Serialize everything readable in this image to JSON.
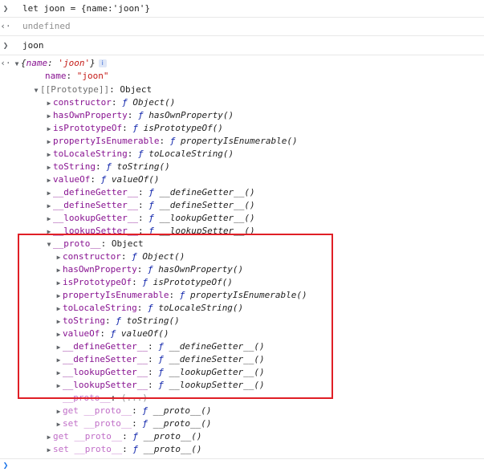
{
  "console": {
    "input1": "let joon = {name:'joon'}",
    "result1": "undefined",
    "input2": "joon",
    "object_preview": {
      "open": "{",
      "key": "name",
      "sep": ": ",
      "value": "'joon'",
      "close": "}"
    },
    "name_prop": {
      "key": "name",
      "value": "\"joon\""
    },
    "prototype_label": {
      "key": "[[Prototype]]",
      "value": "Object"
    },
    "level1_methods": [
      {
        "key": "constructor",
        "sig": "Object()"
      },
      {
        "key": "hasOwnProperty",
        "sig": "hasOwnProperty()"
      },
      {
        "key": "isPrototypeOf",
        "sig": "isPrototypeOf()"
      },
      {
        "key": "propertyIsEnumerable",
        "sig": "propertyIsEnumerable()"
      },
      {
        "key": "toLocaleString",
        "sig": "toLocaleString()"
      },
      {
        "key": "toString",
        "sig": "toString()"
      },
      {
        "key": "valueOf",
        "sig": "valueOf()"
      },
      {
        "key": "__defineGetter__",
        "sig": "__defineGetter__()"
      },
      {
        "key": "__defineSetter__",
        "sig": "__defineSetter__()"
      },
      {
        "key": "__lookupGetter__",
        "sig": "__lookupGetter__()"
      },
      {
        "key": "__lookupSetter__",
        "sig": "__lookupSetter__()"
      }
    ],
    "proto_label": {
      "key": "__proto__",
      "value": "Object"
    },
    "level2_methods": [
      {
        "key": "constructor",
        "sig": "Object()"
      },
      {
        "key": "hasOwnProperty",
        "sig": "hasOwnProperty()"
      },
      {
        "key": "isPrototypeOf",
        "sig": "isPrototypeOf()"
      },
      {
        "key": "propertyIsEnumerable",
        "sig": "propertyIsEnumerable()"
      },
      {
        "key": "toLocaleString",
        "sig": "toLocaleString()"
      },
      {
        "key": "toString",
        "sig": "toString()"
      },
      {
        "key": "valueOf",
        "sig": "valueOf()"
      },
      {
        "key": "__defineGetter__",
        "sig": "__defineGetter__()"
      },
      {
        "key": "__defineSetter__",
        "sig": "__defineSetter__()"
      },
      {
        "key": "__lookupGetter__",
        "sig": "__lookupGetter__()"
      },
      {
        "key": "__lookupSetter__",
        "sig": "__lookupSetter__()"
      }
    ],
    "level2_tail": [
      {
        "key": "__proto__",
        "value": "(...)"
      },
      {
        "key": "get __proto__",
        "sig": "__proto__()"
      },
      {
        "key": "set __proto__",
        "sig": "__proto__()"
      }
    ],
    "level1_tail": [
      {
        "key": "get __proto__",
        "sig": "__proto__()"
      },
      {
        "key": "set __proto__",
        "sig": "__proto__()"
      }
    ],
    "function_marker": "ƒ",
    "info_icon_text": "i"
  },
  "colors": {
    "highlight_border": "#e01f26",
    "string": "#c41a16",
    "property_key": "#881391",
    "function": "#0d22aa"
  },
  "icons": {
    "input_prompt": "chevron-right-icon",
    "result_prompt": "result-arrow-icon",
    "expand_open": "triangle-down-icon",
    "expand_closed": "triangle-right-icon",
    "info": "info-icon"
  }
}
